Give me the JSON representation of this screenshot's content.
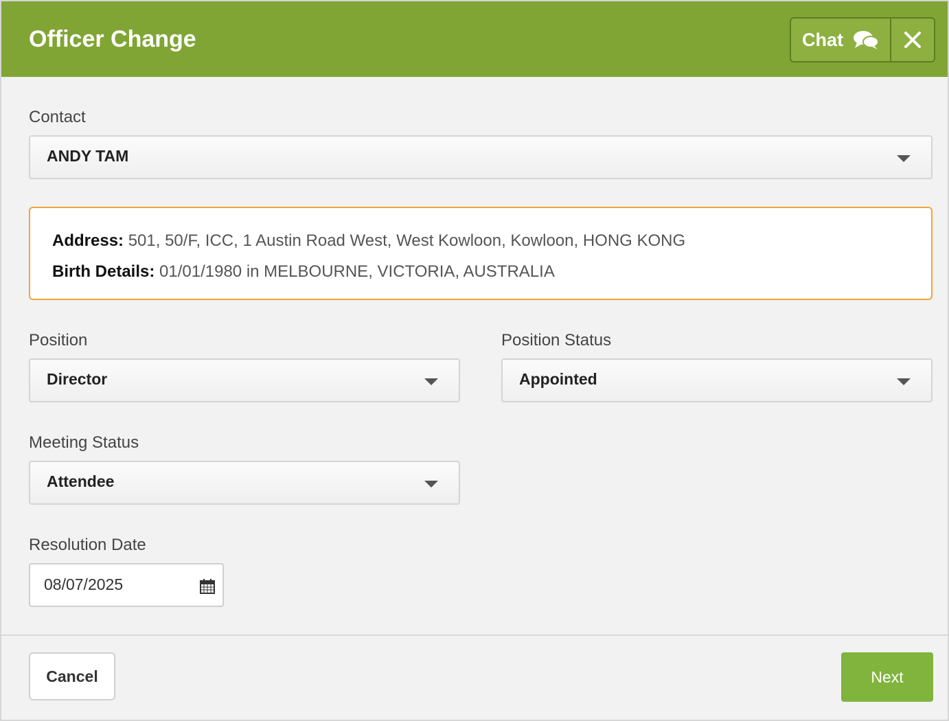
{
  "header": {
    "title": "Officer Change",
    "chat_label": "Chat",
    "accent_color": "#80a534"
  },
  "contact": {
    "label": "Contact",
    "value": "ANDY TAM"
  },
  "details": {
    "address_label": "Address:",
    "address_value": "501, 50/F, ICC, 1 Austin Road West, West Kowloon, Kowloon, HONG KONG",
    "birth_label": "Birth Details:",
    "birth_value": "01/01/1980 in MELBOURNE, VICTORIA, AUSTRALIA"
  },
  "position": {
    "label": "Position",
    "value": "Director"
  },
  "position_status": {
    "label": "Position Status",
    "value": "Appointed"
  },
  "meeting_status": {
    "label": "Meeting Status",
    "value": "Attendee"
  },
  "resolution_date": {
    "label": "Resolution Date",
    "value": "08/07/2025"
  },
  "footer": {
    "cancel_label": "Cancel",
    "next_label": "Next"
  },
  "icons": {
    "chat": "chat-bubbles-icon",
    "close": "close-icon",
    "calendar": "calendar-icon",
    "dropdown": "chevron-down-icon"
  }
}
